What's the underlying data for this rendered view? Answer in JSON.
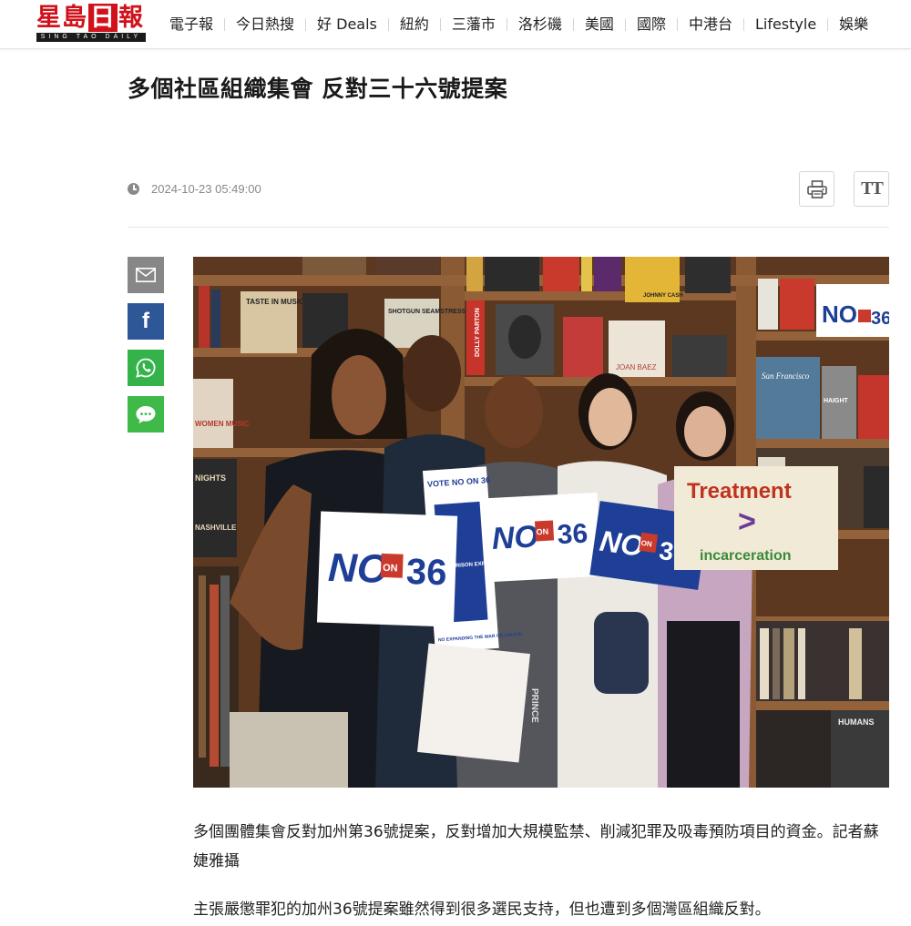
{
  "logo": {
    "main": "星島日報",
    "main_a": "星島",
    "main_b": "日",
    "main_c": "報",
    "sub": "SING TAO DAILY"
  },
  "nav": {
    "items": [
      "電子報",
      "今日熱搜",
      "好 Deals",
      "紐約",
      "三藩市",
      "洛杉磯",
      "美國",
      "國際",
      "中港台",
      "Lifestyle",
      "娛樂"
    ]
  },
  "article": {
    "title": "多個社區組織集會 反對三十六號提案",
    "timestamp": "2024-10-23 05:49:00",
    "paragraphs": [
      "多個團體集會反對加州第36號提案，反對增加大規模監禁、削減犯罪及吸毒預防項目的資金。記者蘇婕雅攝",
      "主張嚴懲罪犯的加州36號提案雖然得到很多選民支持，但也遭到多個灣區組織反對。"
    ]
  },
  "photo": {
    "signs": {
      "no": "NO",
      "on": "ON",
      "num": "36",
      "treatment": "Treatment",
      "greater": ">",
      "incarceration": "incarceration",
      "vote": "VOTE NO ON 36",
      "no_prison": "NO PRISON EXPANSION",
      "no_war": "NO EXPANDING THE WAR ON DRUGS!"
    },
    "books": {
      "taste": "TASTE IN MUSIC",
      "shotgun": "SHOTGUN SEAMSTRESS",
      "dolly": "DOLLY PARTON",
      "johnny": "JOHNNY CASH",
      "women": "WOMEN MUSIC",
      "joan": "JOAN BAEZ",
      "sf": "San Francisco",
      "haight": "HAIGHT",
      "nights": "NIGHTS",
      "nashville": "NASHVILLE",
      "prince": "PRINCE",
      "humans": "HUMANS"
    }
  },
  "share": {
    "icons": [
      "mail-icon",
      "facebook-icon",
      "whatsapp-icon",
      "message-icon"
    ],
    "fb_glyph": "f"
  },
  "tools": {
    "font_glyph": "TT"
  },
  "colors": {
    "brand_red": "#d1121b",
    "facebook": "#2d5796",
    "whatsapp": "#33b34a",
    "message": "#3fba49",
    "mail": "#878787",
    "sign_blue": "#1f3f97"
  }
}
